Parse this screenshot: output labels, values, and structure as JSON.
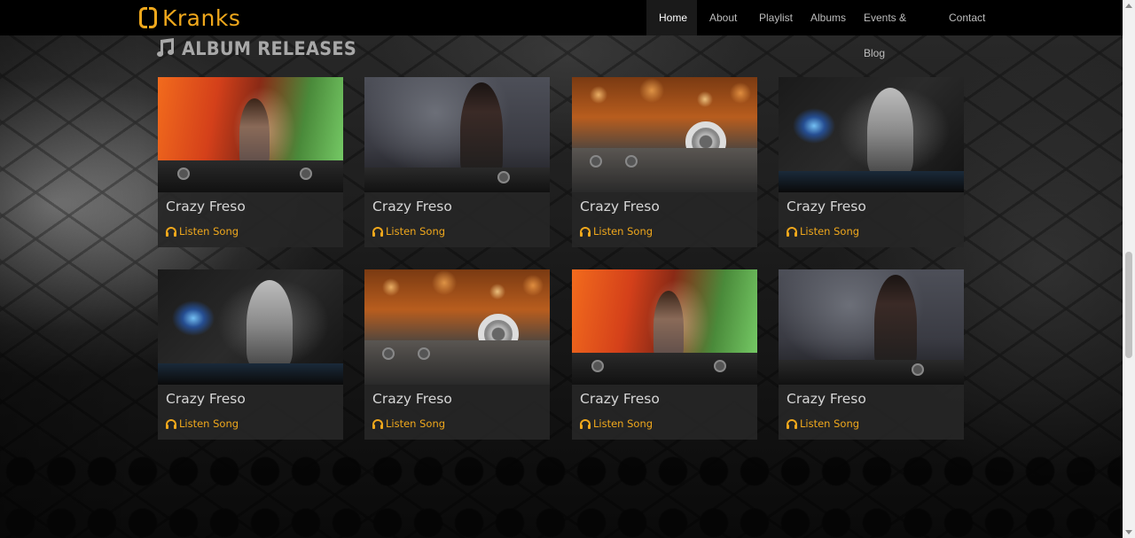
{
  "brand": {
    "name": "Kranks",
    "accent": "#f0a81c"
  },
  "nav": {
    "items": [
      {
        "label": "Home",
        "active": true
      },
      {
        "label": "About",
        "active": false
      },
      {
        "label": "Playlist",
        "active": false
      },
      {
        "label": "Albums",
        "active": false
      },
      {
        "label": "Events & Blog",
        "active": false
      },
      {
        "label": "Contact",
        "active": false
      }
    ]
  },
  "section": {
    "title": "ALBUM RELEASES",
    "icon": "music-note-icon"
  },
  "albums": [
    {
      "title": "Crazy Freso",
      "action": "Listen Song",
      "image": "dj-girl-rainbow-lights"
    },
    {
      "title": "Crazy Freso",
      "action": "Listen Song",
      "image": "dj-girl-studio-mixer"
    },
    {
      "title": "Crazy Freso",
      "action": "Listen Song",
      "image": "headphones-on-mixer"
    },
    {
      "title": "Crazy Freso",
      "action": "Listen Song",
      "image": "dj-hoodie-neon-hand"
    },
    {
      "title": "Crazy Freso",
      "action": "Listen Song",
      "image": "dj-hoodie-neon-hand"
    },
    {
      "title": "Crazy Freso",
      "action": "Listen Song",
      "image": "headphones-on-mixer"
    },
    {
      "title": "Crazy Freso",
      "action": "Listen Song",
      "image": "dj-girl-rainbow-lights"
    },
    {
      "title": "Crazy Freso",
      "action": "Listen Song",
      "image": "dj-girl-studio-mixer"
    }
  ]
}
